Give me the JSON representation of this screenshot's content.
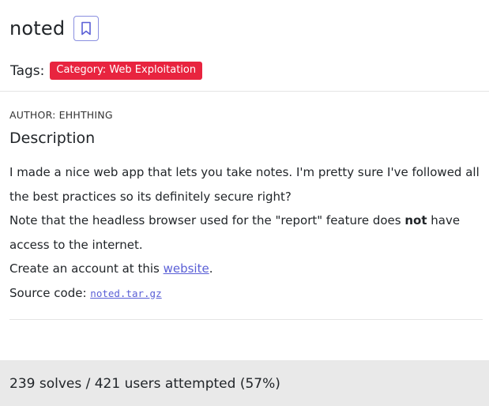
{
  "challenge": {
    "title": "noted",
    "bookmark_icon": "bookmark-icon"
  },
  "tags": {
    "label": "Tags:",
    "items": [
      {
        "text": "Category: Web Exploitation",
        "color": "#e8243f"
      }
    ]
  },
  "author": {
    "text": "AUTHOR: EHHTHING"
  },
  "description": {
    "heading": "Description",
    "line1": "I made a nice web app that lets you take notes. I'm pretty sure I've followed all the best practices so its definitely secure right?",
    "line2_before": "Note that the headless browser used for the \"report\" feature does ",
    "line2_bold": "not",
    "line2_after": " have access to the internet.",
    "line3_before": "Create an account at this ",
    "line3_link": "website",
    "line3_after": ".",
    "line4_before": "Source code: ",
    "line4_link": "noted.tar.gz"
  },
  "stats": {
    "text": "239 solves / 421 users attempted (57%)"
  },
  "colors": {
    "accent": "#5a5fd6",
    "badge": "#e8243f",
    "footer_bg": "#e9e9e9"
  }
}
